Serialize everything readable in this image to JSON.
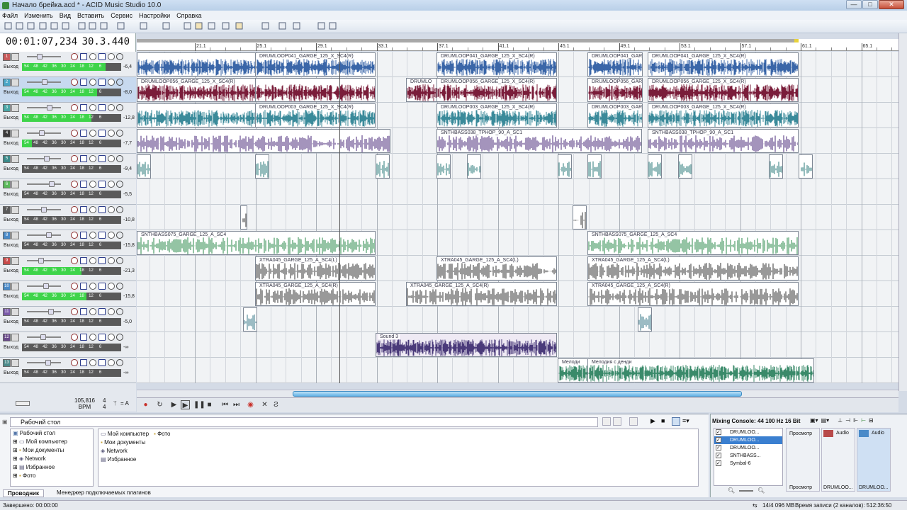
{
  "window": {
    "title": "Начало брейка.acd * - ACID Music Studio 10.0"
  },
  "menu": [
    "Файл",
    "Изменить",
    "Вид",
    "Вставить",
    "Сервис",
    "Настройки",
    "Справка"
  ],
  "time": {
    "position": "00:01:07,234",
    "measure": "30.3.440"
  },
  "ruler": {
    "labels": [
      "21.1",
      "25.1",
      "29.1",
      "33.1",
      "37.1",
      "41.1",
      "45.1",
      "49.1",
      "53.1",
      "57.1",
      "61.1",
      "65.1"
    ]
  },
  "tracks": [
    {
      "out": "Выход",
      "db": "-6,4",
      "color": "#c85a5a",
      "meter": 0.84,
      "meter_labels": [
        "54",
        "48",
        "42",
        "36",
        "30",
        "24",
        "18",
        "12",
        "6"
      ]
    },
    {
      "out": "Выход",
      "db": "-8,0",
      "color": "#4aa6c8",
      "meter": 0.76,
      "meter_labels": [
        "54",
        "48",
        "42",
        "36",
        "30",
        "24",
        "18",
        "12",
        "6"
      ],
      "selected": true
    },
    {
      "out": "Выход",
      "db": "-12,8",
      "color": "#4aa6a6",
      "meter": 0.7,
      "meter_labels": [
        "54",
        "48",
        "42",
        "36",
        "30",
        "24",
        "18",
        "12",
        "6"
      ]
    },
    {
      "out": "Выход",
      "db": "-7,7",
      "color": "#3a3a3a",
      "meter": 0.1,
      "meter_labels": [
        "54",
        "48",
        "42",
        "36",
        "30",
        "24",
        "18",
        "12",
        "6"
      ]
    },
    {
      "out": "Выход",
      "db": "-9,4",
      "color": "#3a8a8a",
      "meter": 0.0,
      "meter_labels": [
        "54",
        "48",
        "42",
        "36",
        "30",
        "24",
        "18",
        "12",
        "6"
      ]
    },
    {
      "out": "Выход",
      "db": "-5,5",
      "color": "#5ab85a",
      "meter": 0.0,
      "meter_labels": [
        "54",
        "48",
        "42",
        "36",
        "30",
        "24",
        "18",
        "12",
        "6"
      ]
    },
    {
      "out": "Выход",
      "db": "-10,8",
      "color": "#5a5a5a",
      "meter": 0.0,
      "meter_labels": [
        "54",
        "48",
        "42",
        "36",
        "30",
        "24",
        "18",
        "12",
        "6"
      ]
    },
    {
      "out": "Выход",
      "db": "-15,8",
      "color": "#4a8ac8",
      "meter": 0.0,
      "meter_labels": [
        "54",
        "48",
        "42",
        "36",
        "30",
        "24",
        "18",
        "12",
        "6"
      ]
    },
    {
      "out": "Выход",
      "db": "-21,3",
      "color": "#c84a4a",
      "meter": 0.6,
      "meter_labels": [
        "54",
        "48",
        "42",
        "36",
        "30",
        "24",
        "18",
        "12",
        "6"
      ]
    },
    {
      "out": "Выход",
      "db": "-15,8",
      "color": "#4a8ac8",
      "meter": 0.65,
      "meter_labels": [
        "54",
        "48",
        "42",
        "36",
        "30",
        "24",
        "18",
        "12",
        "6"
      ]
    },
    {
      "out": "Выход",
      "db": "-5,0",
      "color": "#7a5aa8",
      "meter": 0.0,
      "meter_labels": [
        "54",
        "48",
        "42",
        "36",
        "30",
        "24",
        "18",
        "12",
        "6"
      ]
    },
    {
      "out": "Выход",
      "db": "-∞",
      "color": "#6a4a8a",
      "meter": 0.0,
      "meter_labels": [
        "54",
        "48",
        "42",
        "36",
        "30",
        "24",
        "18",
        "12",
        "6"
      ]
    },
    {
      "out": "Выход",
      "db": "-∞",
      "color": "#4a8a8a",
      "meter": 0.0,
      "meter_labels": [
        "54",
        "48",
        "42",
        "36",
        "30",
        "24",
        "18",
        "12",
        "6"
      ]
    }
  ],
  "clip_names": {
    "t1": "DRUMLOOP041_GARGE_125_X_SC4(R)",
    "t2": "DRUMLOOP056_GARGE_125_X_SC4(R)",
    "t2b": "DRUMLO",
    "t3": "DRUMLOOP003_GARGE_125_X_SC4(R)",
    "t4": "SNTHBASS038_TPHOP_90_A_SC1",
    "t8": "SNTHBASS075_GARGE_125_A_SC4",
    "t9": "XTRA045_GARGE_125_A_SC4(L)",
    "t10": "XTRA045_GARGE_125_A_SC4(R)",
    "t12": "Sound 3",
    "t13a": "Мелоди",
    "t13b": "Мелодия с денди"
  },
  "bpm": {
    "value": "105,816",
    "label": "BPM",
    "sig_top": "4",
    "sig_bottom": "4",
    "eq": "= A"
  },
  "explorer": {
    "address": "Рабочий стол",
    "tree": [
      "Рабочий стол",
      "Мой компьютер",
      "Мои документы",
      "Network",
      "Избранное",
      "Фото"
    ],
    "files": [
      "Мой компьютер",
      "Фото",
      "Мои документы",
      "Network",
      "Избранное"
    ],
    "tab1": "Проводник",
    "tab2": "Менеджер подключаемых плагинов"
  },
  "mixer": {
    "title": "Mixing Console: 44 100 Hz 16 Bit",
    "list": [
      "DRUMLOO...",
      "DRUMLOO...",
      "DRUMLOO...",
      "SNTHBASS...",
      "Symbal-6"
    ],
    "preview": "Просмотр",
    "ch1": "Audio",
    "ch2": "Audio",
    "preview2": "Просмотр",
    "ch1name": "DRUMLOO...",
    "ch2name": "DRUMLOO..."
  },
  "status": {
    "left": "Завершено: 00:00:00",
    "mid": "14/4 096 MB",
    "right": "Время записи (2 каналов): 512:36:50"
  },
  "colors": {
    "accent": "#3a7fd0"
  }
}
